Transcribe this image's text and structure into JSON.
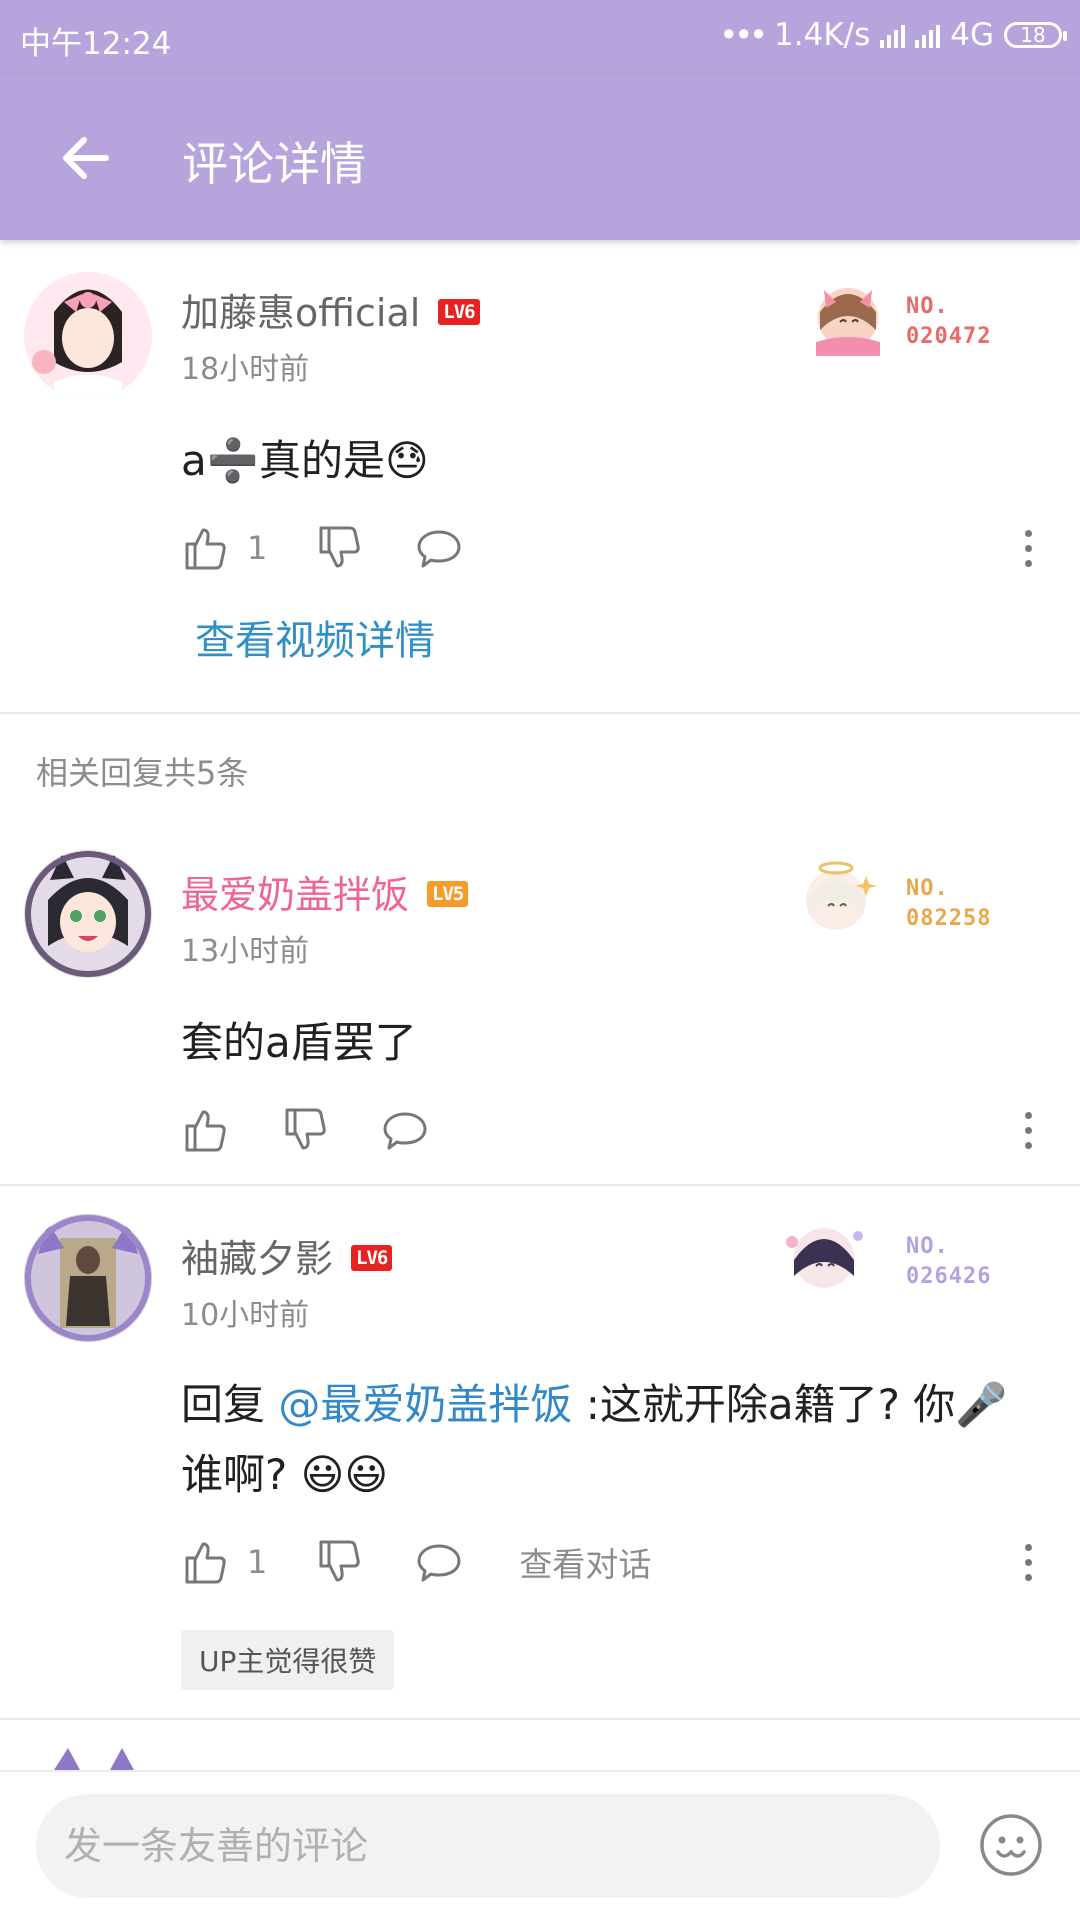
{
  "status_bar": {
    "time": "中午12:24",
    "dots": "•••",
    "speed": "1.4K/s",
    "network": "4G",
    "battery": "18"
  },
  "header": {
    "title": "评论详情"
  },
  "main_comment": {
    "username": "加藤惠official",
    "level": "LV6",
    "fan_no_label": "NO.",
    "fan_no": "020472",
    "time": "18小时前",
    "content": "a➗真的是😓",
    "like_count": "1",
    "view_video_link": "查看视频详情"
  },
  "replies_header": "相关回复共5条",
  "replies": [
    {
      "username": "最爱奶盖拌饭",
      "level": "LV5",
      "fan_no_label": "NO.",
      "fan_no": "082258",
      "time": "13小时前",
      "content": "套的a盾罢了"
    },
    {
      "username": "袖藏夕影",
      "level": "LV6",
      "fan_no_label": "NO.",
      "fan_no": "026426",
      "time": "10小时前",
      "reply_prefix": "回复 ",
      "mention": "@最爱奶盖拌饭",
      "content": " :这就开除a籍了? 你🎤谁啊? 😃😃",
      "like_count": "1",
      "view_dialogue": "查看对话",
      "up_tag": "UP主觉得很赞"
    }
  ],
  "input": {
    "placeholder": "发一条友善的评论"
  },
  "colors": {
    "header_bg": "#b8a4dc",
    "link_blue": "#2f8fc7",
    "pink_name": "#f06493",
    "lv6_red": "#e82222",
    "lv5_orange": "#f39c2a"
  }
}
